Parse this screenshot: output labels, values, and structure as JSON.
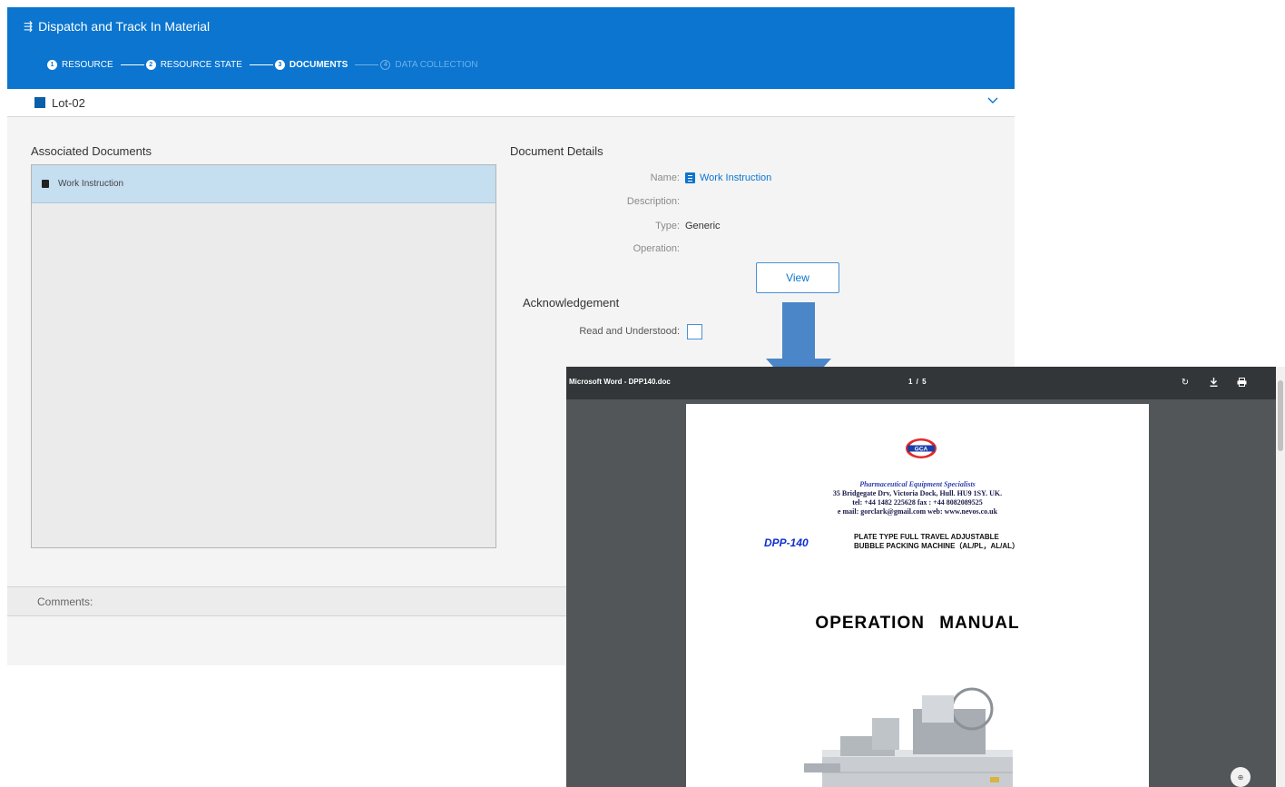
{
  "wizard": {
    "title": "Dispatch and Track In Material",
    "steps": [
      {
        "num": "1",
        "label": "RESOURCE",
        "state": "done"
      },
      {
        "num": "2",
        "label": "RESOURCE STATE",
        "state": "done"
      },
      {
        "num": "3",
        "label": "DOCUMENTS",
        "state": "active"
      },
      {
        "num": "4",
        "label": "DATA COLLECTION",
        "state": "future"
      }
    ],
    "lot": "Lot-02",
    "associated_documents": {
      "heading": "Associated Documents",
      "items": [
        {
          "label": "Work Instruction",
          "selected": true
        }
      ]
    },
    "document_details": {
      "heading": "Document Details",
      "name_label": "Name:",
      "name_value": "Work Instruction",
      "description_label": "Description:",
      "description_value": "",
      "type_label": "Type:",
      "type_value": "Generic",
      "operation_label": "Operation:",
      "operation_value": ""
    },
    "view_button": "View",
    "acknowledgement": {
      "heading": "Acknowledgement",
      "read_label": "Read and Understood:",
      "checked": false
    },
    "comments_label": "Comments:"
  },
  "pdf_viewer": {
    "filename": "Microsoft Word - DPP140.doc",
    "page_indicator": "1 / 5",
    "tools": [
      "rotate-icon",
      "download-icon",
      "print-icon"
    ],
    "document": {
      "logo_text": "GCA",
      "tagline": "Pharmaceutical Equipment Specialists",
      "address": "35 Bridgegate Drv, Victoria Dock, Hull. HU9 1SY. UK.",
      "phone": "tel: +44 1482 225628 fax : +44 8082089525",
      "email": "e mail: gorclark@gmail.com web: www.nevos.co.uk",
      "model": "DPP-140",
      "machine_line1": "PLATE TYPE FULL TRAVEL ADJUSTABLE",
      "machine_line2": "BUBBLE PACKING MACHINE（AL/PL，AL/AL）",
      "title": "OPERATION  MANUAL"
    }
  },
  "colors": {
    "header_blue": "#0b75cf",
    "arrow_blue": "#4a86c8",
    "viewer_toolbar": "#323639",
    "viewer_background": "#525659"
  }
}
